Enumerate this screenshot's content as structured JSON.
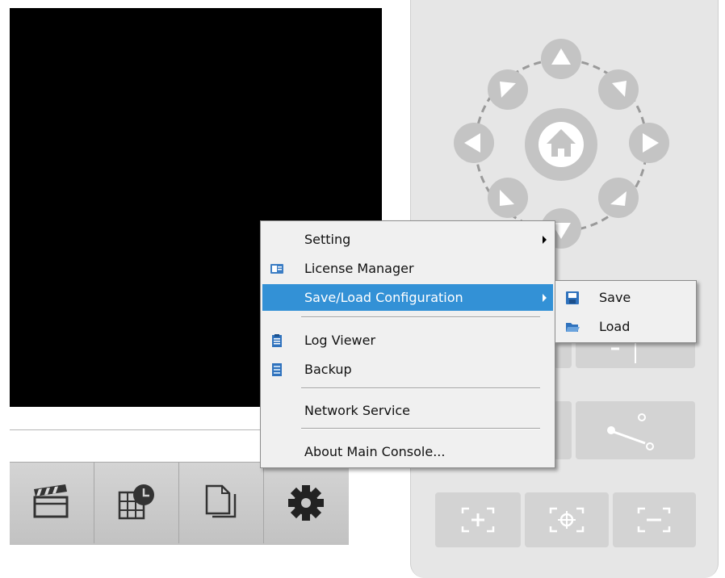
{
  "menu": {
    "items": [
      {
        "label": "Setting",
        "icon": "none",
        "has_submenu": true
      },
      {
        "label": "License Manager",
        "icon": "license-card-icon",
        "has_submenu": false
      },
      {
        "label": "Save/Load Configuration",
        "icon": "none",
        "has_submenu": true,
        "highlighted": true
      },
      {
        "label": "Log Viewer",
        "icon": "clipboard-icon",
        "has_submenu": false
      },
      {
        "label": "Backup",
        "icon": "backup-server-icon",
        "has_submenu": false
      },
      {
        "label": "Network Service",
        "icon": "none",
        "has_submenu": false
      },
      {
        "label": "About Main Console...",
        "icon": "none",
        "has_submenu": false
      }
    ]
  },
  "submenu": {
    "items": [
      {
        "label": "Save",
        "icon": "floppy-disk-icon"
      },
      {
        "label": "Load",
        "icon": "open-folder-icon"
      }
    ]
  },
  "toolbar": {
    "buttons": [
      {
        "icon": "clapperboard-icon"
      },
      {
        "icon": "schedule-grid-clock-icon"
      },
      {
        "icon": "copy-document-icon"
      },
      {
        "icon": "gear-icon"
      }
    ]
  },
  "ptz": {
    "direction_buttons": [
      "up",
      "up-right",
      "right",
      "down-right",
      "down",
      "down-left",
      "left",
      "up-left"
    ],
    "home_icon": "home-icon",
    "zoom_buttons": [
      {
        "icon": "zoom-in-icon"
      },
      {
        "icon": "focus-center-icon"
      },
      {
        "icon": "zoom-out-icon"
      }
    ]
  },
  "colors": {
    "menu_highlight": "#3391d6",
    "menu_bg": "#f0f0f0",
    "panel_bg": "#e6e6e6",
    "button_gray": "#c4c4c4"
  }
}
